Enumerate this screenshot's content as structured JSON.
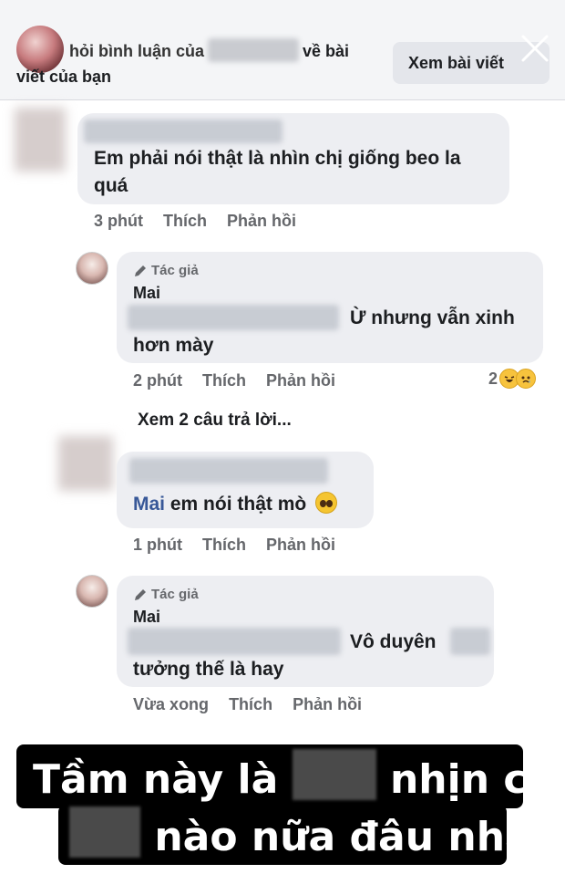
{
  "header": {
    "text_lead": "hỏi bình luận của",
    "text_tail": "về bài",
    "text_line2": "viết của bạn",
    "view_post_label": "Xem bài viết"
  },
  "comments": [
    {
      "text": "Em phải nói thật là nhìn chị giống beo la quá",
      "text_line1": "Em phải nói thật là nhìn chị giống beo la",
      "text_line2": "quá",
      "time": "3 phút",
      "like": "Thích",
      "reply": "Phản hồi"
    },
    {
      "author_tag": "Tác giả",
      "author": "Mai",
      "text_line1": "Ừ nhưng vẫn xinh",
      "text_line2": "hơn mày",
      "time": "2 phút",
      "like": "Thích",
      "reply": "Phản hồi",
      "reaction_count": "2"
    },
    {
      "mention": "Mai",
      "text": "em nói thật mò",
      "time": "1 phút",
      "like": "Thích",
      "reply": "Phản hồi"
    },
    {
      "author_tag": "Tác giả",
      "author": "Mai",
      "text_line1": "Vô duyên",
      "text_line2": "tưởng thế là hay",
      "time": "Vừa xong",
      "like": "Thích",
      "reply": "Phản hồi"
    }
  ],
  "see_replies": "Xem 2 câu trả lời...",
  "caption": {
    "line1_a": "Tầm này là",
    "line1_b": "nhịn con",
    "line2": "nào nữa đâu nha"
  },
  "icons": {
    "close": "close-icon",
    "pencil": "pencil-icon",
    "haha": "haha-reaction-icon",
    "sad": "sad-reaction-icon",
    "pleading": "pleading-face-emoji"
  },
  "colors": {
    "bubble": "#edeef2",
    "meta": "#65676b",
    "mention": "#385898",
    "caption_bg": "#000000"
  }
}
